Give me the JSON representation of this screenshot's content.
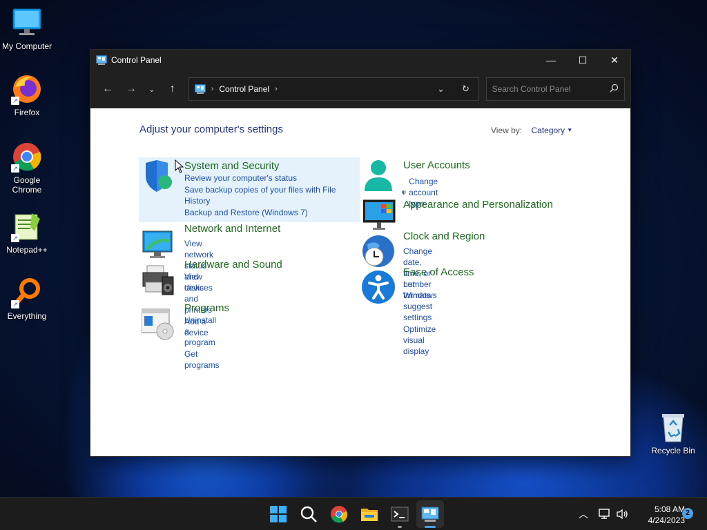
{
  "desktop": {
    "icons": [
      {
        "label": "My Computer"
      },
      {
        "label": "Firefox"
      },
      {
        "label": "Google Chrome"
      },
      {
        "label": "Notepad++"
      },
      {
        "label": "Everything"
      },
      {
        "label": "Recycle Bin"
      }
    ]
  },
  "window": {
    "title": "Control Panel",
    "minimize_glyph": "—",
    "maximize_glyph": "☐",
    "close_glyph": "✕"
  },
  "toolbar": {
    "breadcrumb": "Control Panel",
    "search_placeholder": "Search Control Panel"
  },
  "content": {
    "heading": "Adjust your computer's settings",
    "view_by_label": "View by:",
    "view_by_value": "Category",
    "categories": [
      {
        "title": "System and Security",
        "links": [
          "Review your computer's status",
          "Save backup copies of your files with File History",
          "Backup and Restore (Windows 7)"
        ]
      },
      {
        "title": "Network and Internet",
        "links": [
          "View network status and tasks"
        ]
      },
      {
        "title": "Hardware and Sound",
        "links": [
          "View devices and printers",
          "Add a device"
        ]
      },
      {
        "title": "Programs",
        "links": [
          "Uninstall a program",
          "Get programs"
        ]
      },
      {
        "title": "User Accounts",
        "links": [
          "Change account type"
        ]
      },
      {
        "title": "Appearance and Personalization",
        "links": []
      },
      {
        "title": "Clock and Region",
        "links": [
          "Change date, time, or number formats"
        ]
      },
      {
        "title": "Ease of Access",
        "links": [
          "Let Windows suggest settings",
          "Optimize visual display"
        ]
      }
    ]
  },
  "taskbar": {
    "time": "5:08 AM",
    "date": "4/24/2023",
    "notification_count": "2"
  }
}
